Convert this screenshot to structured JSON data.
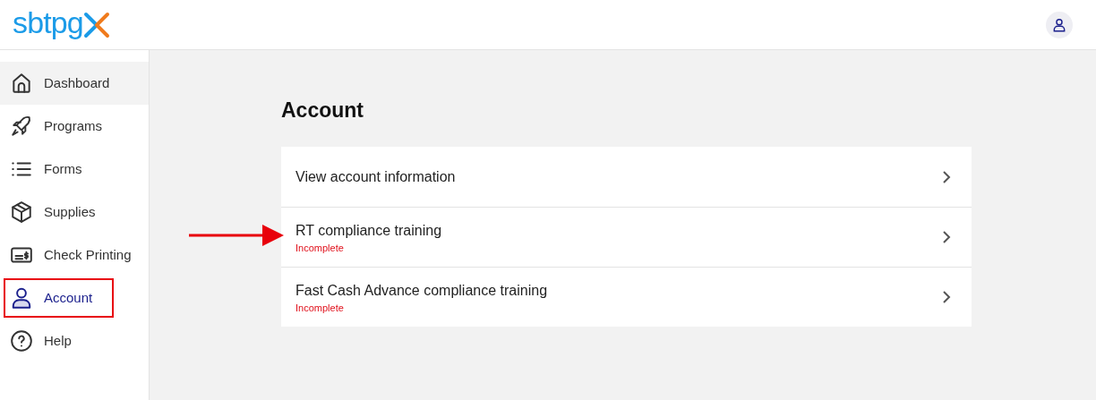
{
  "header": {
    "logo_text": "sbtpg"
  },
  "sidebar": {
    "items": [
      {
        "label": "Dashboard",
        "selected": false,
        "hovered": true,
        "marked": false
      },
      {
        "label": "Programs",
        "selected": false,
        "hovered": false,
        "marked": false
      },
      {
        "label": "Forms",
        "selected": false,
        "hovered": false,
        "marked": false
      },
      {
        "label": "Supplies",
        "selected": false,
        "hovered": false,
        "marked": false
      },
      {
        "label": "Check Printing",
        "selected": false,
        "hovered": false,
        "marked": false
      },
      {
        "label": "Account",
        "selected": true,
        "hovered": false,
        "marked": true
      },
      {
        "label": "Help",
        "selected": false,
        "hovered": false,
        "marked": false
      }
    ]
  },
  "page": {
    "title": "Account",
    "rows": [
      {
        "label": "View account information",
        "marked": false
      },
      {
        "label": "RT compliance training",
        "status": "Incomplete",
        "marked": true
      },
      {
        "label": "Fast Cash Advance compliance training",
        "status": "Incomplete",
        "marked": false
      }
    ]
  }
}
